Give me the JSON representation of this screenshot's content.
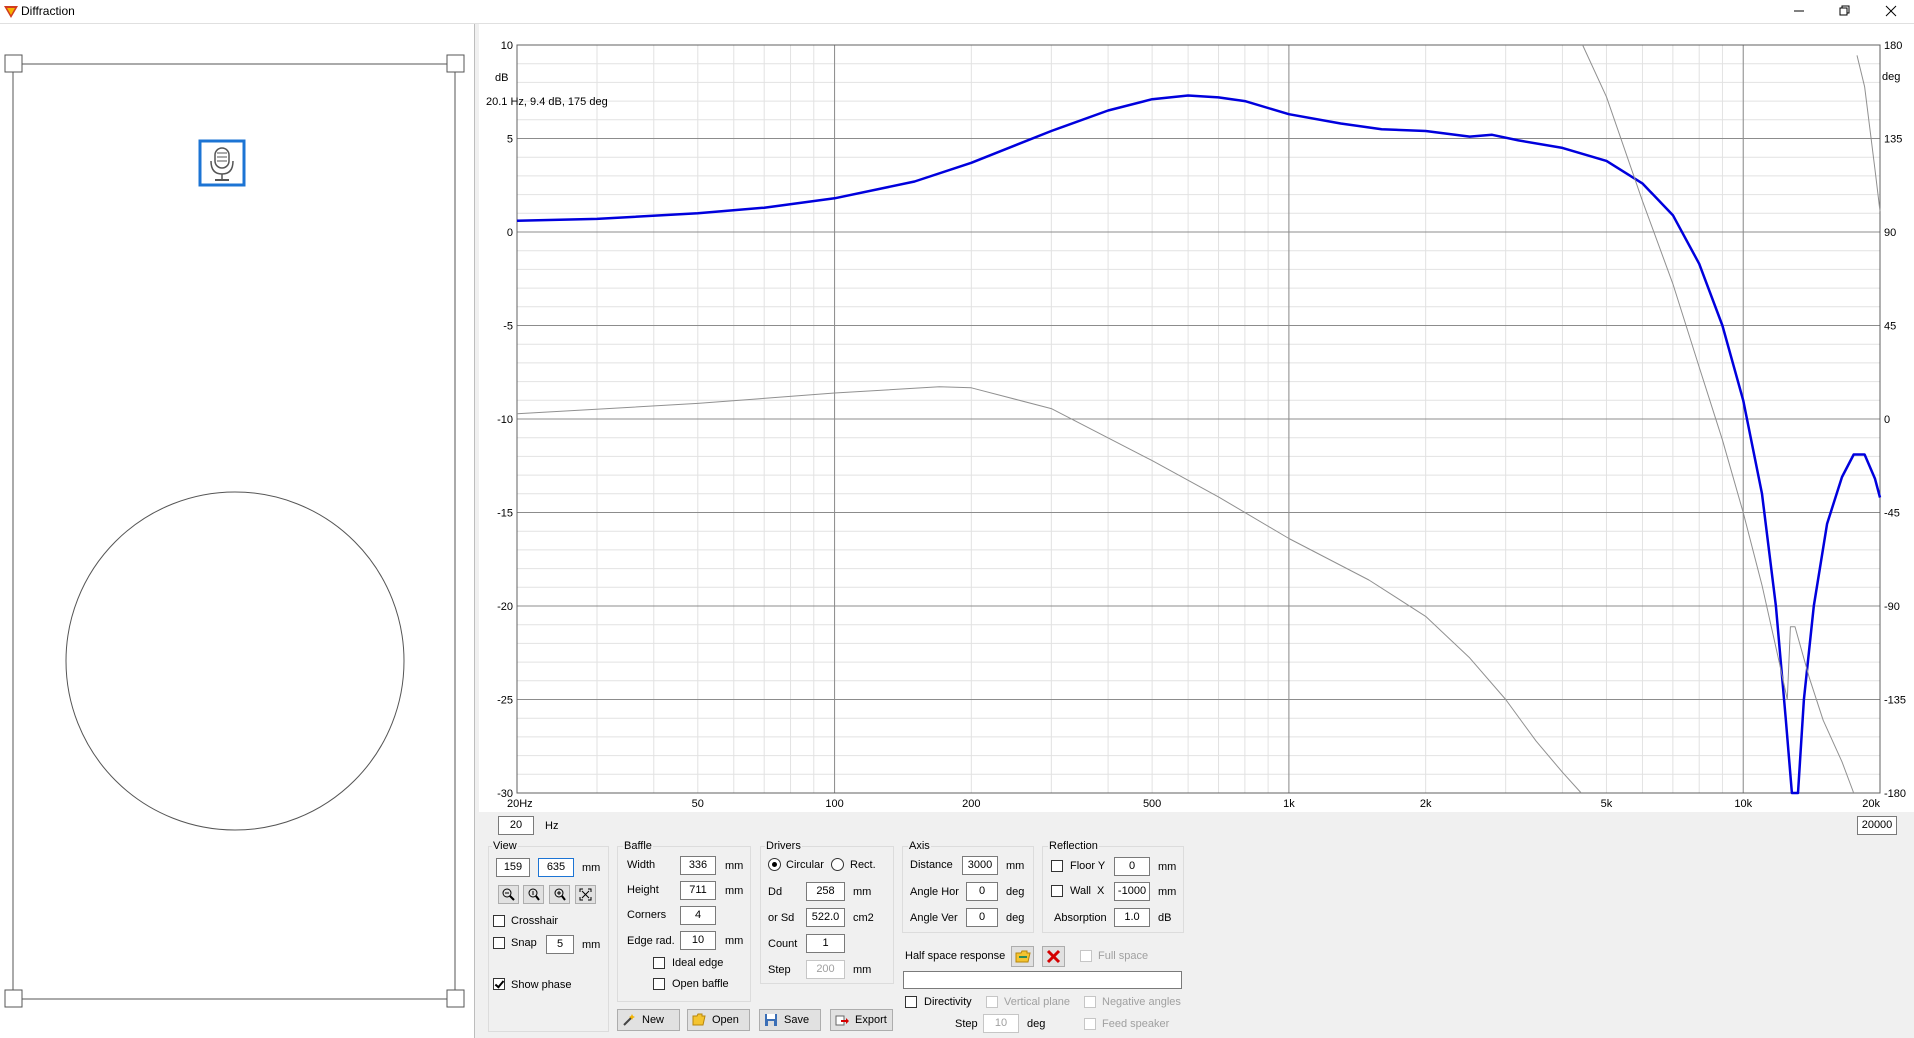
{
  "window": {
    "title": "Diffraction",
    "controls": [
      "minimize-icon",
      "restore-icon",
      "close-icon"
    ]
  },
  "graph": {
    "cursor_readout": "20.1 Hz, 9.4 dB, 175 deg",
    "left_unit": "dB",
    "right_unit": "deg",
    "freq_min_input": "20",
    "freq_min_unit": "Hz",
    "freq_max_input": "20000"
  },
  "chart_data": {
    "type": "line",
    "x_scale": "log",
    "xlim": [
      20,
      20000
    ],
    "ylim_left": [
      -30,
      10
    ],
    "ylim_right": [
      -180,
      180
    ],
    "grid": true,
    "x_ticks": [
      20,
      50,
      100,
      200,
      500,
      1000,
      2000,
      5000,
      10000,
      20000
    ],
    "x_tick_labels": [
      "20Hz",
      "50",
      "100",
      "200",
      "500",
      "1k",
      "2k",
      "5k",
      "10k",
      "20k"
    ],
    "y_ticks_left": [
      10,
      5,
      0,
      -5,
      -10,
      -15,
      -20,
      -25,
      -30
    ],
    "y_tick_labels_left": [
      "10",
      "5",
      "0",
      "-5",
      "-10",
      "-15",
      "-20",
      "-25",
      "-30"
    ],
    "y_ticks_right": [
      180,
      135,
      90,
      45,
      0,
      -45,
      -90,
      -135,
      -180
    ],
    "y_tick_labels_right": [
      "180",
      "135",
      "90",
      "45",
      "0",
      "-45",
      "-90",
      "-135",
      "-180"
    ],
    "series": [
      {
        "axis": "left",
        "color": "#0000dd",
        "points": [
          [
            20,
            0.6
          ],
          [
            30,
            0.7
          ],
          [
            50,
            1.0
          ],
          [
            70,
            1.3
          ],
          [
            100,
            1.8
          ],
          [
            150,
            2.7
          ],
          [
            200,
            3.7
          ],
          [
            300,
            5.4
          ],
          [
            400,
            6.5
          ],
          [
            500,
            7.1
          ],
          [
            600,
            7.3
          ],
          [
            700,
            7.2
          ],
          [
            800,
            7.0
          ],
          [
            1000,
            6.3
          ],
          [
            1300,
            5.8
          ],
          [
            1600,
            5.5
          ],
          [
            2000,
            5.4
          ],
          [
            2500,
            5.1
          ],
          [
            2800,
            5.2
          ],
          [
            3200,
            4.9
          ],
          [
            4000,
            4.5
          ],
          [
            5000,
            3.8
          ],
          [
            6000,
            2.6
          ],
          [
            7000,
            0.9
          ],
          [
            8000,
            -1.7
          ],
          [
            9000,
            -5.0
          ],
          [
            10000,
            -9.0
          ],
          [
            11000,
            -14.0
          ],
          [
            11800,
            -20.0
          ],
          [
            12400,
            -26.0
          ],
          [
            12800,
            -30.0
          ],
          [
            13200,
            -30.0
          ],
          [
            13600,
            -25.0
          ],
          [
            14300,
            -20.0
          ],
          [
            15300,
            -15.6
          ],
          [
            16500,
            -13.1
          ],
          [
            17500,
            -11.9
          ],
          [
            18500,
            -11.9
          ],
          [
            19500,
            -13.2
          ],
          [
            20000,
            -14.2
          ]
        ]
      },
      {
        "axis": "right",
        "color": "#909090",
        "points": [
          [
            20,
            2.5
          ],
          [
            50,
            7.5
          ],
          [
            100,
            12.5
          ],
          [
            170,
            15.5
          ],
          [
            200,
            15
          ],
          [
            300,
            5
          ],
          [
            500,
            -20
          ],
          [
            700,
            -37.5
          ],
          [
            1000,
            -57.5
          ],
          [
            1500,
            -77.5
          ],
          [
            2000,
            -95
          ],
          [
            2500,
            -115
          ],
          [
            3000,
            -135
          ],
          [
            3500,
            -155
          ],
          [
            4000,
            -170
          ],
          [
            4400,
            -180
          ],
          [
            4430,
            180
          ],
          [
            5000,
            155
          ],
          [
            6000,
            105
          ],
          [
            7000,
            65
          ],
          [
            8000,
            25
          ],
          [
            9000,
            -10
          ],
          [
            10000,
            -45
          ],
          [
            11000,
            -80
          ],
          [
            12000,
            -117
          ],
          [
            12500,
            -135
          ],
          [
            12700,
            -100
          ],
          [
            13000,
            -100
          ],
          [
            14000,
            -125
          ],
          [
            15000,
            -145
          ],
          [
            16500,
            -165
          ],
          [
            17500,
            -180
          ],
          [
            17800,
            175
          ],
          [
            18500,
            160
          ],
          [
            19500,
            120
          ],
          [
            20000,
            100
          ]
        ]
      }
    ]
  },
  "view": {
    "title": "View",
    "x_value": "159",
    "y_value": "635",
    "unit": "mm",
    "crosshair_label": "Crosshair",
    "crosshair_checked": false,
    "snap_label": "Snap",
    "snap_checked": false,
    "snap_value": "5",
    "snap_unit": "mm",
    "show_phase_label": "Show phase",
    "show_phase_checked": true,
    "zoom_icons": [
      "zoom-out-icon",
      "zoom-in-icon",
      "zoom-in-plus-icon",
      "fit-view-icon"
    ]
  },
  "baffle": {
    "title": "Baffle",
    "width_label": "Width",
    "width_value": "336",
    "width_unit": "mm",
    "height_label": "Height",
    "height_value": "711",
    "height_unit": "mm",
    "corners_label": "Corners",
    "corners_value": "4",
    "edge_label": "Edge rad.",
    "edge_value": "10",
    "edge_unit": "mm",
    "ideal_edge_label": "Ideal edge",
    "ideal_edge_checked": false,
    "open_baffle_label": "Open baffle",
    "open_baffle_checked": false
  },
  "drivers": {
    "title": "Drivers",
    "circular_label": "Circular",
    "circular_selected": true,
    "rect_label": "Rect.",
    "rect_selected": false,
    "dd_label": "Dd",
    "dd_value": "258",
    "dd_unit": "mm",
    "sd_label": "or Sd",
    "sd_value": "522.0",
    "sd_unit": "cm2",
    "count_label": "Count",
    "count_value": "1",
    "step_label": "Step",
    "step_value": "200",
    "step_unit": "mm"
  },
  "axis": {
    "title": "Axis",
    "distance_label": "Distance",
    "distance_value": "3000",
    "distance_unit": "mm",
    "angle_hor_label": "Angle Hor",
    "angle_hor_value": "0",
    "angle_hor_unit": "deg",
    "angle_ver_label": "Angle Ver",
    "angle_ver_value": "0",
    "angle_ver_unit": "deg"
  },
  "reflection": {
    "title": "Reflection",
    "floor_label": "Floor Y",
    "floor_checked": false,
    "floor_value": "0",
    "floor_unit": "mm",
    "wall_label": "Wall",
    "wall_axis": "X",
    "wall_checked": false,
    "wall_value": "-1000",
    "wall_unit": "mm",
    "absorption_label": "Absorption",
    "absorption_value": "1.0",
    "absorption_unit": "dB"
  },
  "half_space": {
    "label": "Half space response",
    "full_space_label": "Full space",
    "full_space_checked": false,
    "field_value": ""
  },
  "directivity": {
    "label": "Directivity",
    "checked": false,
    "vertical_plane_label": "Vertical plane",
    "negative_angles_label": "Negative angles",
    "feed_speaker_label": "Feed speaker",
    "step_label": "Step",
    "step_value": "10",
    "step_unit": "deg"
  },
  "actions": {
    "new_label": "New",
    "open_label": "Open",
    "save_label": "Save",
    "export_label": "Export"
  },
  "colors": {
    "magnitude_curve": "#0000dd",
    "phase_curve": "#909090",
    "mic_highlight": "#1c74d4"
  }
}
